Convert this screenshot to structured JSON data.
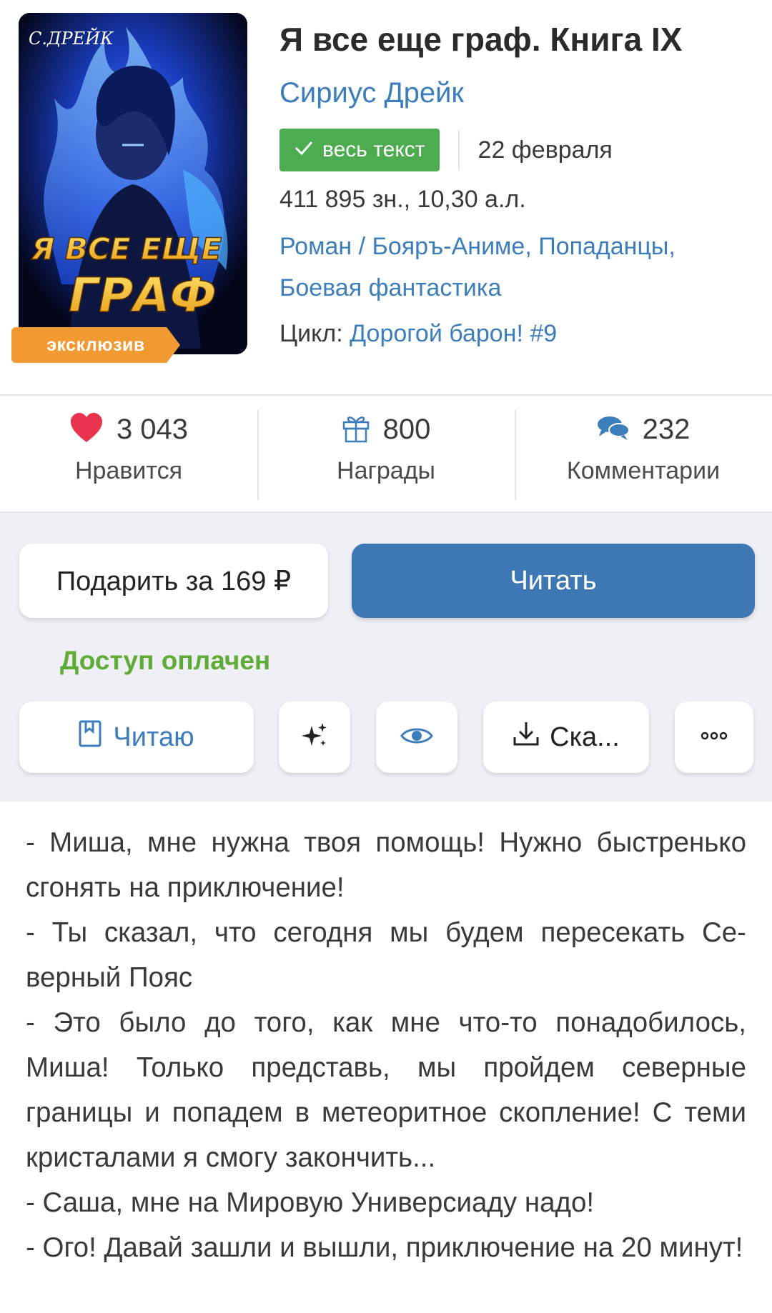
{
  "cover": {
    "author_text": "С.ДРЕЙК",
    "title_line1": "Я ВСЕ ЕЩЕ",
    "title_line2": "ГРАФ",
    "exclusive_badge": "эксклюзив"
  },
  "book": {
    "title": "Я все еще граф. Книга IX",
    "author": "Сириус Дрейк",
    "status": "весь текст",
    "status_color": "#4dac4f",
    "date": "22 февраля",
    "size": "411 895 зн., 10,30 а.л.",
    "genres": {
      "primary": "Роман",
      "separator": " / ",
      "items": [
        "Бояръ-Аниме",
        "Попаданцы",
        "Боевая фантастика"
      ]
    },
    "cycle_label": "Цикл: ",
    "cycle_name": "Дорогой барон! #9"
  },
  "stats": {
    "likes": {
      "count": "3 043",
      "label": "Нравится",
      "icon": "heart-icon"
    },
    "awards": {
      "count": "800",
      "label": "Награды",
      "icon": "gift-icon"
    },
    "comments": {
      "count": "232",
      "label": "Комментарии",
      "icon": "comments-icon"
    }
  },
  "actions": {
    "gift_label": "Подарить за 169 ₽",
    "read_label": "Читать",
    "read_color": "#3d78b4",
    "access_text": "Доступ оплачен",
    "access_color": "#5fab35",
    "reading_label": "Читаю",
    "download_label": "Ска..."
  },
  "description": {
    "paragraphs": [
      "- Миша, мне нужна твоя помощь! Нужно бы­стренько сгонять на приключение!",
      "- Ты сказал, что сегодня мы будем пересекать Се­верный Пояс",
      "- Это было до того, как мне что-то понадобилось, Миша! Только представь, мы пройдем северные границы и попадем в метеоритное скопление! С теми кристалами я смогу закончить...",
      "- Саша, мне на Мировую Универсиаду надо!",
      "- Ого! Давай зашли и вышли, приключение на 20 минут!"
    ]
  },
  "colors": {
    "link": "#3c7dbb",
    "heart": "#e8344e",
    "background_actions": "#eef0f6",
    "badge_exclusive": "#f19a32"
  }
}
